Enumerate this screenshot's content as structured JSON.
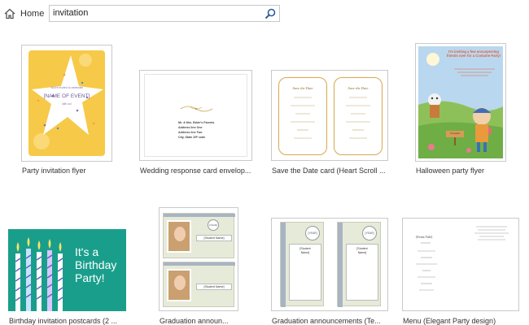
{
  "nav": {
    "home_label": "Home",
    "home_icon": "home-icon"
  },
  "search": {
    "value": "invitation",
    "icon": "search-icon"
  },
  "templates": [
    {
      "title": "Party invitation flyer",
      "thumb": {
        "line1": "You're invited to celebrate",
        "event": "[NAME OF EVENT]",
        "line2": "with us!"
      }
    },
    {
      "title": "Wedding response card envelop...",
      "thumb": {
        "lines": [
          "Mr. & Mrs. Bride's Parents",
          "Address line One",
          "Address line Two",
          "City, State ZIP code"
        ]
      }
    },
    {
      "title": "Save the Date card (Heart Scroll ...",
      "thumb": {
        "heading": "Save the Date"
      }
    },
    {
      "title": "Halloween party flyer",
      "thumb": {
        "heading": "I'm inviting a few unsuspecting friends over for a Costume Party!",
        "sign": "Trespass"
      }
    },
    {
      "title": "Birthday invitation postcards (2 ...",
      "thumb": {
        "line1": "It's a",
        "line2": "Birthday",
        "line3": "Party!"
      }
    },
    {
      "title": "Graduation announ...",
      "thumb": {
        "seal": "[YEAR]",
        "name": "[Student Name]"
      }
    },
    {
      "title": "Graduation announcements (Te...",
      "thumb": {
        "seal": "[YEAR]",
        "name1": "[Student",
        "name2": "Name]"
      }
    },
    {
      "title": "Menu (Elegant Party design)",
      "thumb": {
        "event": "[Event Title]"
      }
    }
  ],
  "colors": {
    "border": "#c9c9c9",
    "accent": "#1e4a8d",
    "flyer": "#f7c948",
    "birthday": "#1a9e8c"
  }
}
